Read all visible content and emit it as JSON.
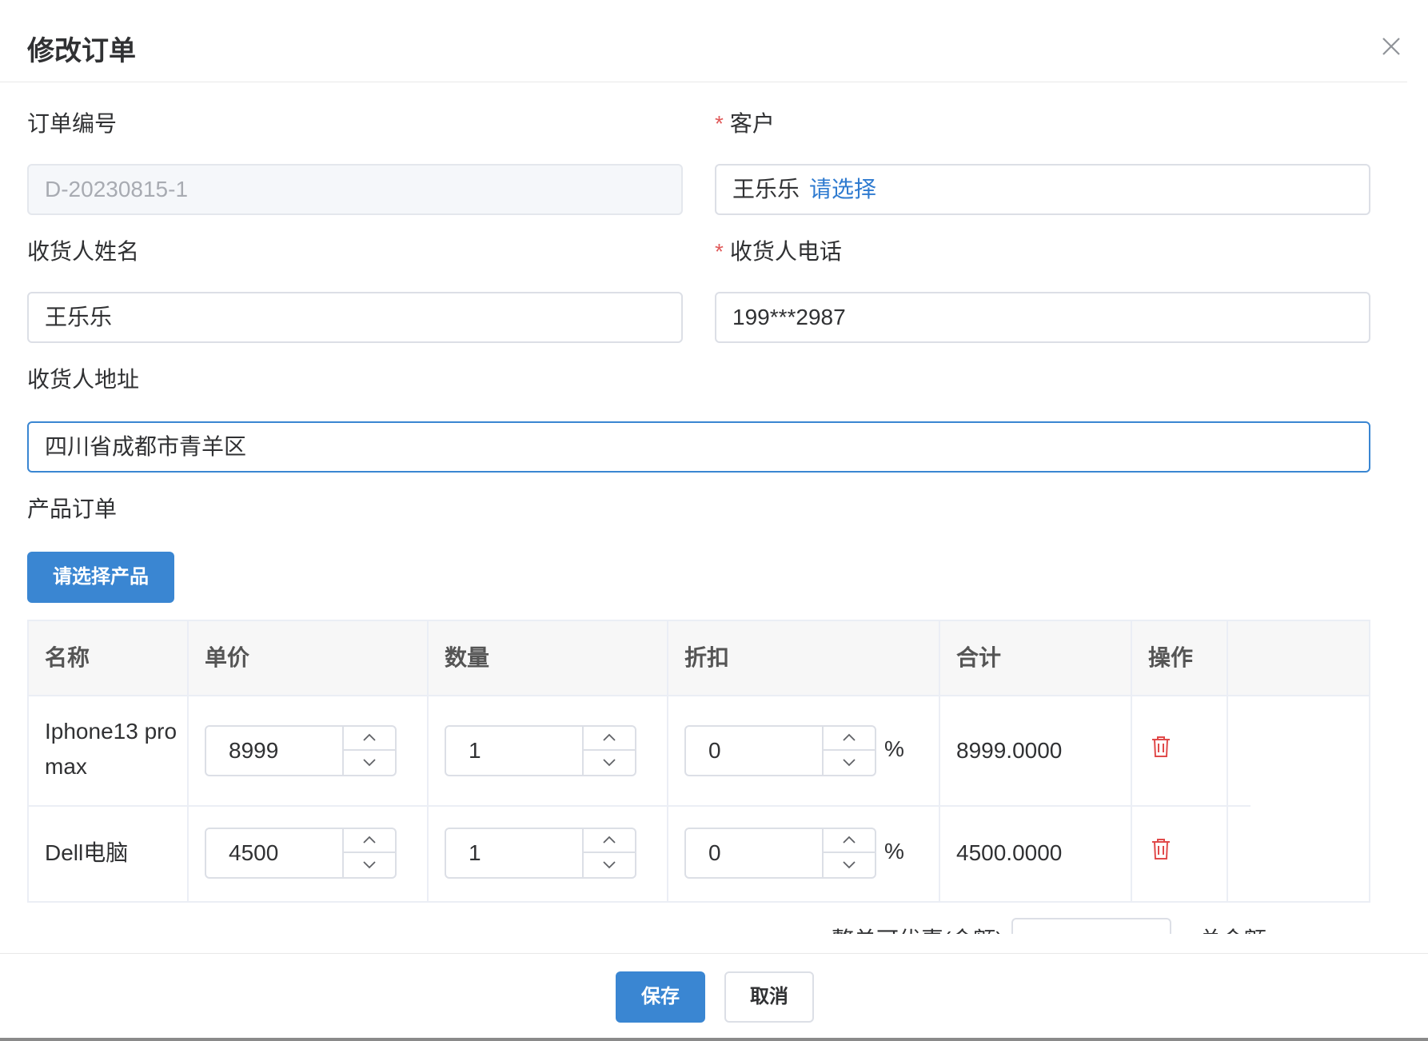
{
  "dialog": {
    "title": "修改订单",
    "close_icon": "close-icon"
  },
  "form": {
    "order_no": {
      "label": "订单编号",
      "value": "D-20230815-1"
    },
    "customer": {
      "label": "客户",
      "value": "王乐乐",
      "select_link": "请选择",
      "required": true
    },
    "receiver_name": {
      "label": "收货人姓名",
      "value": "王乐乐"
    },
    "receiver_phone": {
      "label": "收货人电话",
      "value": "199***2987",
      "required": true
    },
    "receiver_address": {
      "label": "收货人地址",
      "value": "四川省成都市青羊区"
    },
    "products": {
      "label": "产品订单",
      "select_button": "请选择产品"
    }
  },
  "table": {
    "headers": [
      "名称",
      "单价",
      "数量",
      "折扣",
      "合计",
      "操作"
    ],
    "rows": [
      {
        "name": "Iphone13 pro max",
        "price": "8999",
        "quantity": "1",
        "discount": "0",
        "discount_unit": "%",
        "total": "8999.0000"
      },
      {
        "name": "Dell电脑",
        "price": "4500",
        "quantity": "1",
        "discount": "0",
        "discount_unit": "%",
        "total": "4500.0000"
      }
    ]
  },
  "summary_partial": {
    "label_left": "整单可优惠(金额)",
    "label_right": "总金额"
  },
  "footer": {
    "save": "保存",
    "cancel": "取消"
  },
  "colors": {
    "primary": "#3a86d2",
    "link": "#2f7bd0",
    "required": "#e05a5a",
    "delete": "#e04a4a"
  }
}
